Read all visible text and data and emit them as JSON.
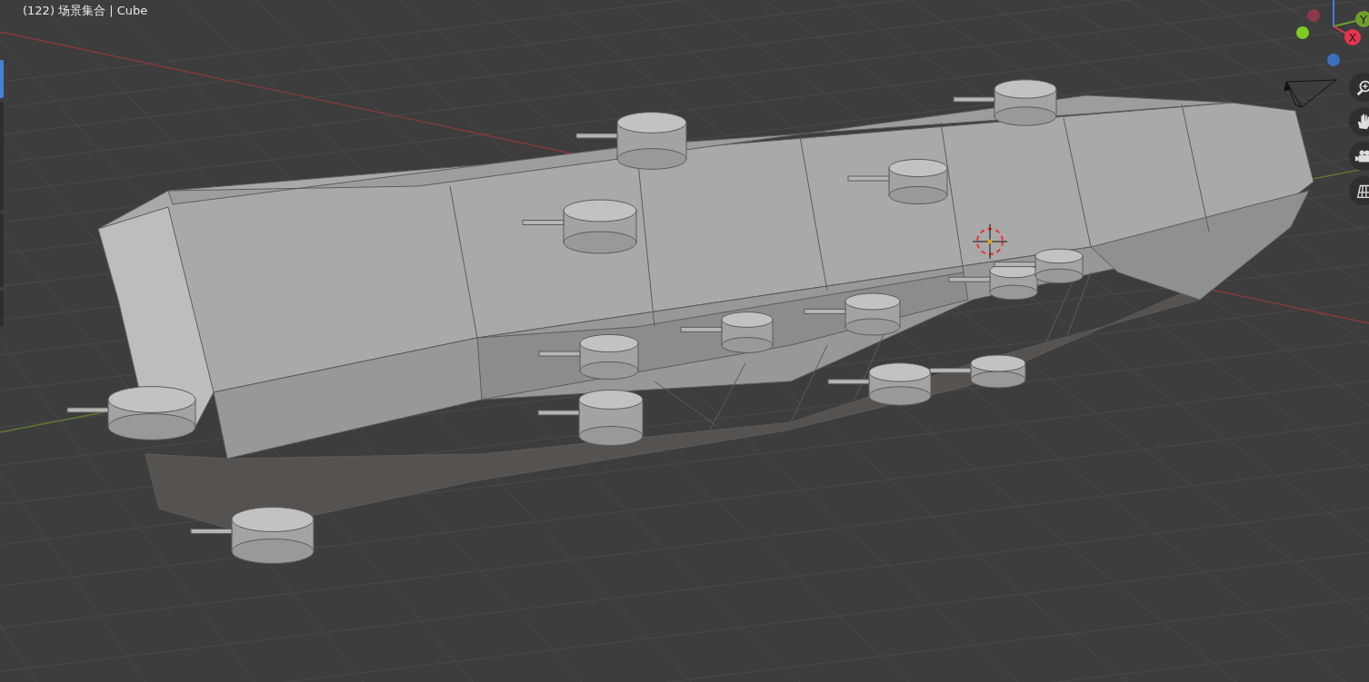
{
  "viewport": {
    "info": "(122) 场景集合 | Cube"
  },
  "toolbar": {
    "tools": [
      {
        "selected": true
      },
      {
        "selected": false
      },
      {
        "selected": false
      },
      {
        "selected": false
      }
    ]
  },
  "gizmo": {
    "axes": [
      {
        "label": "Y",
        "color": "#6f9e2b"
      },
      {
        "label": "X",
        "color": "#e8344f"
      }
    ]
  },
  "navigation": {
    "buttons": [
      {
        "kind": "zoom"
      },
      {
        "kind": "pan"
      },
      {
        "kind": "camera"
      },
      {
        "kind": "ortho"
      }
    ]
  }
}
